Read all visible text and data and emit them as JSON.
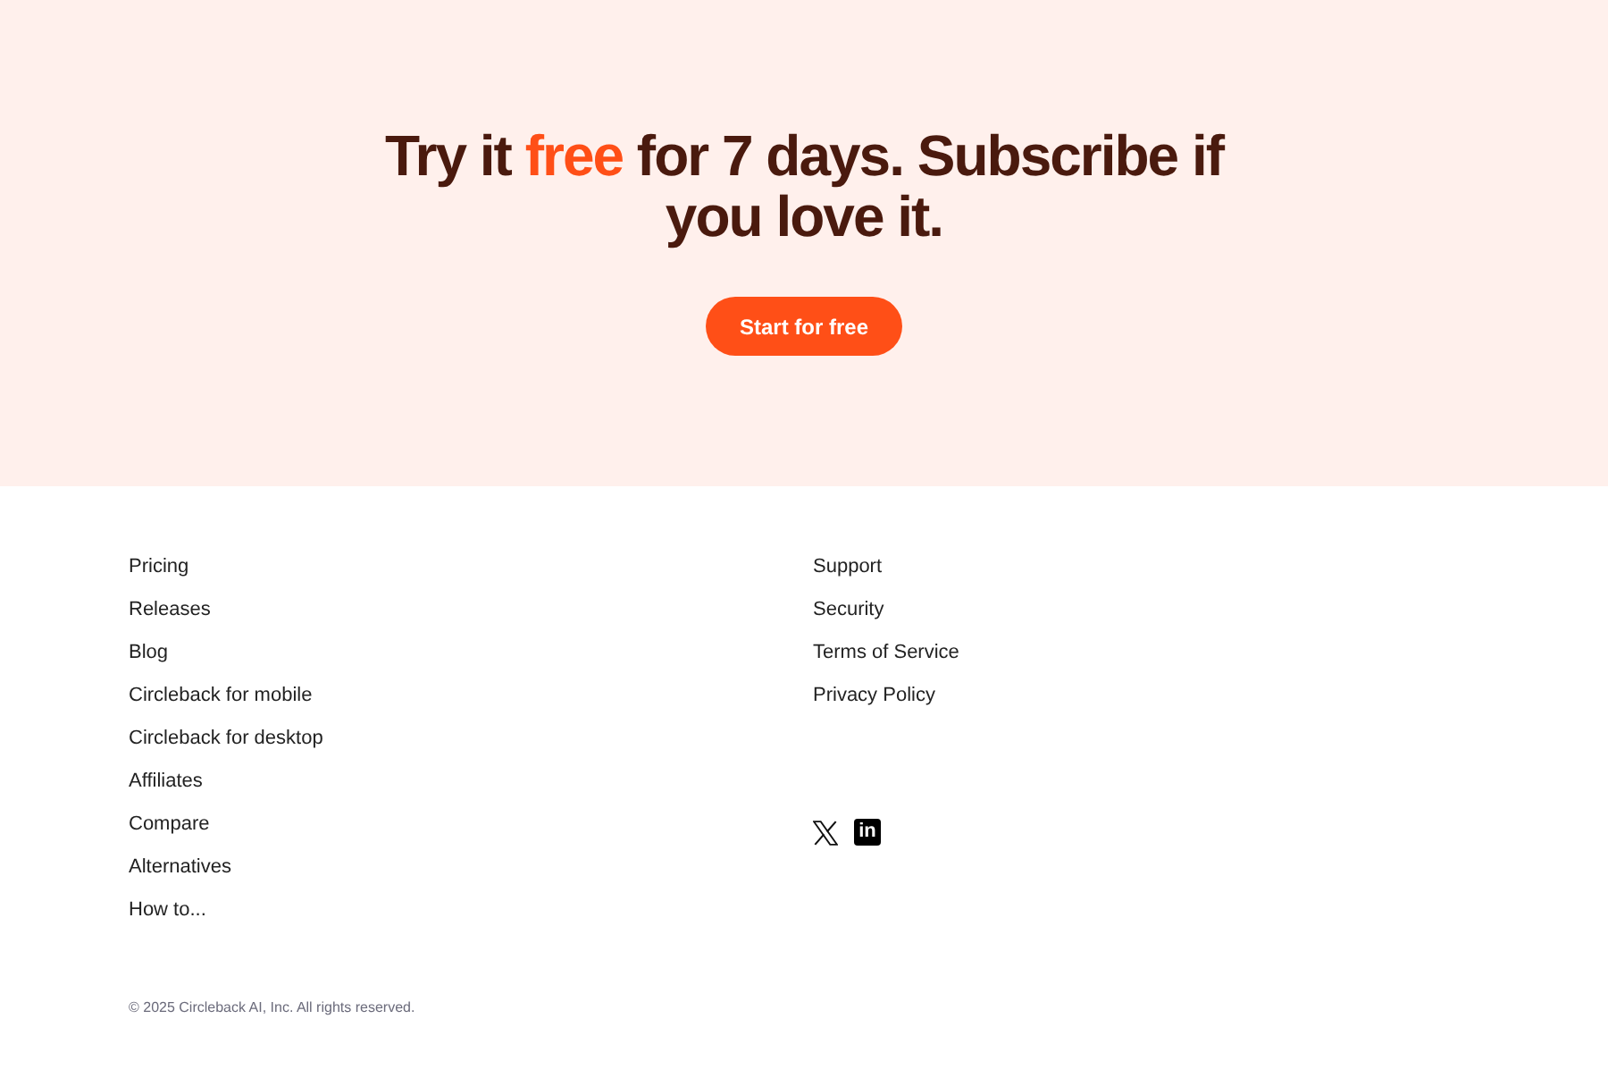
{
  "hero": {
    "headline": "Try it **free** for 7 days. Subscribe if you love it.",
    "button": "Start for free"
  },
  "footer": {
    "links_left": [
      "Pricing",
      "Releases",
      "Blog",
      "Circleback for mobile",
      "Circleback for desktop",
      "Affiliates",
      "Compare",
      "Alternatives",
      "How to..."
    ],
    "links_right": [
      "Support",
      "Security",
      "Terms of Service",
      "Privacy Policy"
    ],
    "social": [
      {
        "kind": "x"
      },
      {
        "kind": "linkedin",
        "label": "in"
      }
    ],
    "copyright": "© 2025 Circleback AI, Inc. All rights reserved."
  }
}
